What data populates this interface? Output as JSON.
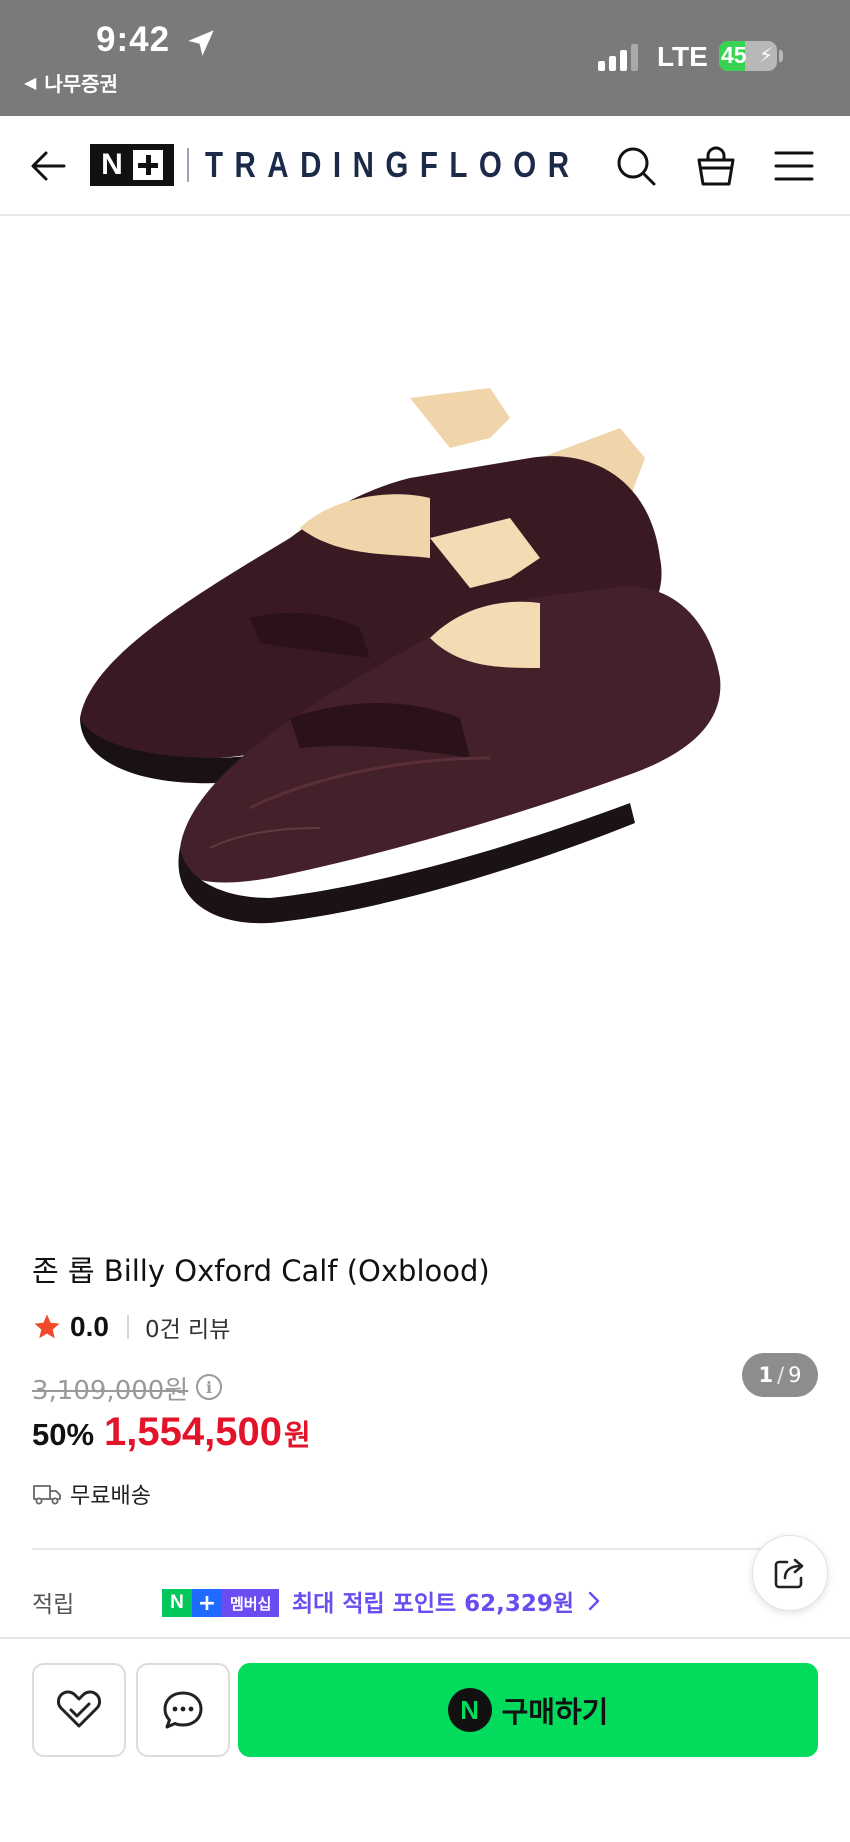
{
  "status_bar": {
    "time": "9:42",
    "back_app": "나무증권",
    "network": "LTE",
    "battery": "45",
    "battery_level": 0.45
  },
  "header": {
    "logo_mark": "N",
    "brand": "TRADINGFLOOR"
  },
  "gallery": {
    "current": "1",
    "separator": "/",
    "total": "9"
  },
  "product": {
    "title": "존 롭 Billy Oxford Calf (Oxblood)",
    "rating": "0.0",
    "review_count": "0건 리뷰",
    "original_price": "3,109,000원",
    "discount": "50%",
    "sale_price": "1,554,500",
    "currency": "원",
    "shipping": "무료배송"
  },
  "points": {
    "label": "적립",
    "badge_n": "N",
    "badge_plus": "+",
    "badge_text": "멤버십",
    "text": "최대 적립 포인트 62,329원"
  },
  "actions": {
    "buy_icon": "N",
    "buy_label": "구매하기"
  },
  "colors": {
    "sale_red": "#e3132a",
    "naver_green": "#03db5c",
    "membership_purple": "#6a4cf0"
  }
}
